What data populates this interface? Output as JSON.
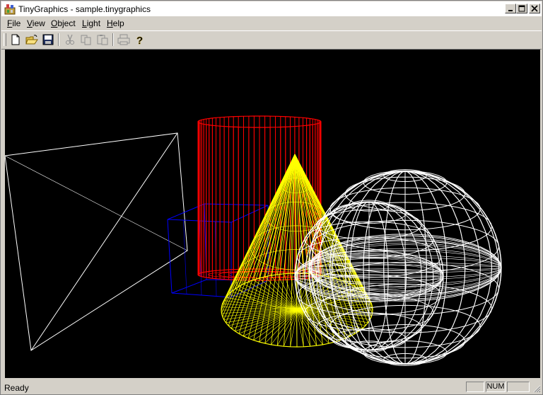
{
  "window": {
    "title": "TinyGraphics - sample.tinygraphics",
    "minimize_glyph": "_",
    "maximize_glyph": "□",
    "close_glyph": "×"
  },
  "menu": {
    "items": [
      {
        "accel": "F",
        "rest": "ile"
      },
      {
        "accel": "V",
        "rest": "iew"
      },
      {
        "accel": "O",
        "rest": "bject"
      },
      {
        "accel": "L",
        "rest": "ight"
      },
      {
        "accel": "H",
        "rest": "elp"
      }
    ]
  },
  "toolbar": {
    "tools": [
      "new-icon",
      "open-icon",
      "save-icon",
      "cut-icon",
      "copy-icon",
      "paste-icon",
      "print-icon",
      "help-icon"
    ],
    "help_glyph": "?"
  },
  "scene": {
    "background": "#000000",
    "objects": [
      {
        "name": "tetrahedron",
        "color": "#ffffff",
        "style": "wireframe"
      },
      {
        "name": "box",
        "color": "#0000ff",
        "style": "wireframe"
      },
      {
        "name": "cylinder",
        "color": "#ff0000",
        "style": "wireframe"
      },
      {
        "name": "cone",
        "color": "#ffff00",
        "style": "wireframe"
      },
      {
        "name": "sphere-large",
        "color": "#ffffff",
        "style": "wireframe"
      },
      {
        "name": "sphere-small",
        "color": "#ffffff",
        "style": "wireframe"
      }
    ]
  },
  "status": {
    "text": "Ready",
    "num": "NUM"
  }
}
